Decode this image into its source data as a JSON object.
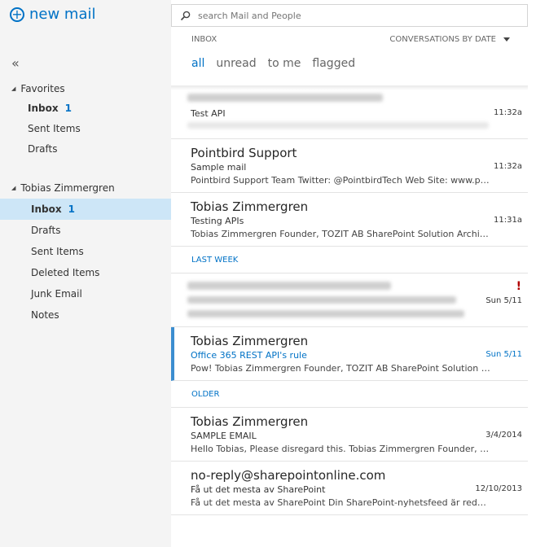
{
  "left": {
    "new_mail": "new mail",
    "collapse": "«",
    "favorites": {
      "header": "Favorites",
      "items": [
        {
          "label": "Inbox",
          "count": "1"
        },
        {
          "label": "Sent Items",
          "count": ""
        },
        {
          "label": "Drafts",
          "count": ""
        }
      ]
    },
    "account": {
      "header": "Tobias Zimmergren",
      "items": [
        {
          "label": "Inbox",
          "count": "1"
        },
        {
          "label": "Drafts",
          "count": ""
        },
        {
          "label": "Sent Items",
          "count": ""
        },
        {
          "label": "Deleted Items",
          "count": ""
        },
        {
          "label": "Junk Email",
          "count": ""
        },
        {
          "label": "Notes",
          "count": ""
        }
      ]
    }
  },
  "search": {
    "placeholder": "search Mail and People"
  },
  "list_header": {
    "folder": "INBOX",
    "sort": "CONVERSATIONS BY DATE"
  },
  "filters": [
    "all",
    "unread",
    "to me",
    "flagged"
  ],
  "messages": [
    {
      "sender": "",
      "subject": "Test API",
      "preview": "",
      "time": "11:32a"
    },
    {
      "sender": "Pointbird Support",
      "subject": "Sample mail",
      "preview": "Pointbird Support Team Twitter: @PointbirdTech Web Site: www.pointbird.com",
      "time": "11:32a"
    },
    {
      "sender": "Tobias Zimmergren",
      "subject": "Testing APIs",
      "preview": "Tobias Zimmergren Founder, TOZIT AB SharePoint Solution Architect",
      "time": "11:31a"
    }
  ],
  "section_last_week": "LAST WEEK",
  "messages_last_week": [
    {
      "sender": "",
      "subject": "",
      "preview": "",
      "time": "Sun 5/11",
      "flag": "!"
    },
    {
      "sender": "Tobias Zimmergren",
      "subject": "Office 365 REST API's rule",
      "preview": "Pow!  Tobias Zimmergren Founder, TOZIT AB SharePoint Solution Architect",
      "time": "Sun 5/11"
    }
  ],
  "section_older": "OLDER",
  "messages_older": [
    {
      "sender": "Tobias Zimmergren",
      "subject": "SAMPLE EMAIL",
      "preview": "Hello Tobias,  Please disregard this.  Tobias Zimmergren Founder, TOZIT AB",
      "time": "3/4/2014"
    },
    {
      "sender": "no-reply@sharepointonline.com",
      "subject": "Få ut det mesta av SharePoint",
      "preview": "Få ut det mesta av SharePoint     Din SharePoint-nyhetsfeed är redo att användas",
      "time": "12/10/2013"
    }
  ]
}
